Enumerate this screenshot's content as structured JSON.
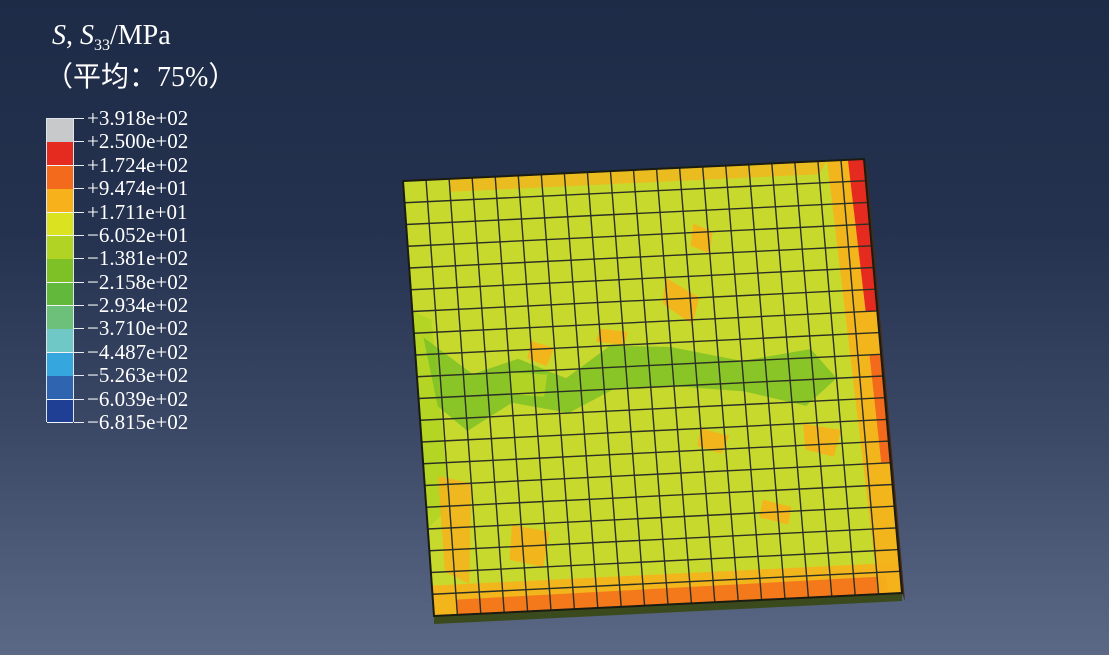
{
  "legend": {
    "title_var": "S",
    "title_sep": ", ",
    "title_comp": "S",
    "title_sub": "33",
    "title_unit": "/MPa",
    "subtitle": "（平均：75%）",
    "colors": [
      "#c8c9cb",
      "#e52b20",
      "#f46a1c",
      "#f6b11b",
      "#dbe21f",
      "#b1d424",
      "#7ec126",
      "#62b83a",
      "#6dc07a",
      "#6fc7c6",
      "#36a6de",
      "#2f65b0",
      "#1f3f94"
    ],
    "labels": [
      "+3.918e+02",
      "+2.500e+02",
      "+1.724e+02",
      "+9.474e+01",
      "+1.711e+01",
      "−6.052e+01",
      "−1.381e+02",
      "−2.158e+02",
      "−2.934e+02",
      "−3.710e+02",
      "−4.487e+02",
      "−5.263e+02",
      "−6.039e+02",
      "−6.815e+02"
    ]
  },
  "model": {
    "grid_divisions": 20,
    "base_color": "#c8d92e",
    "mesh_color": "#2b2f24"
  }
}
